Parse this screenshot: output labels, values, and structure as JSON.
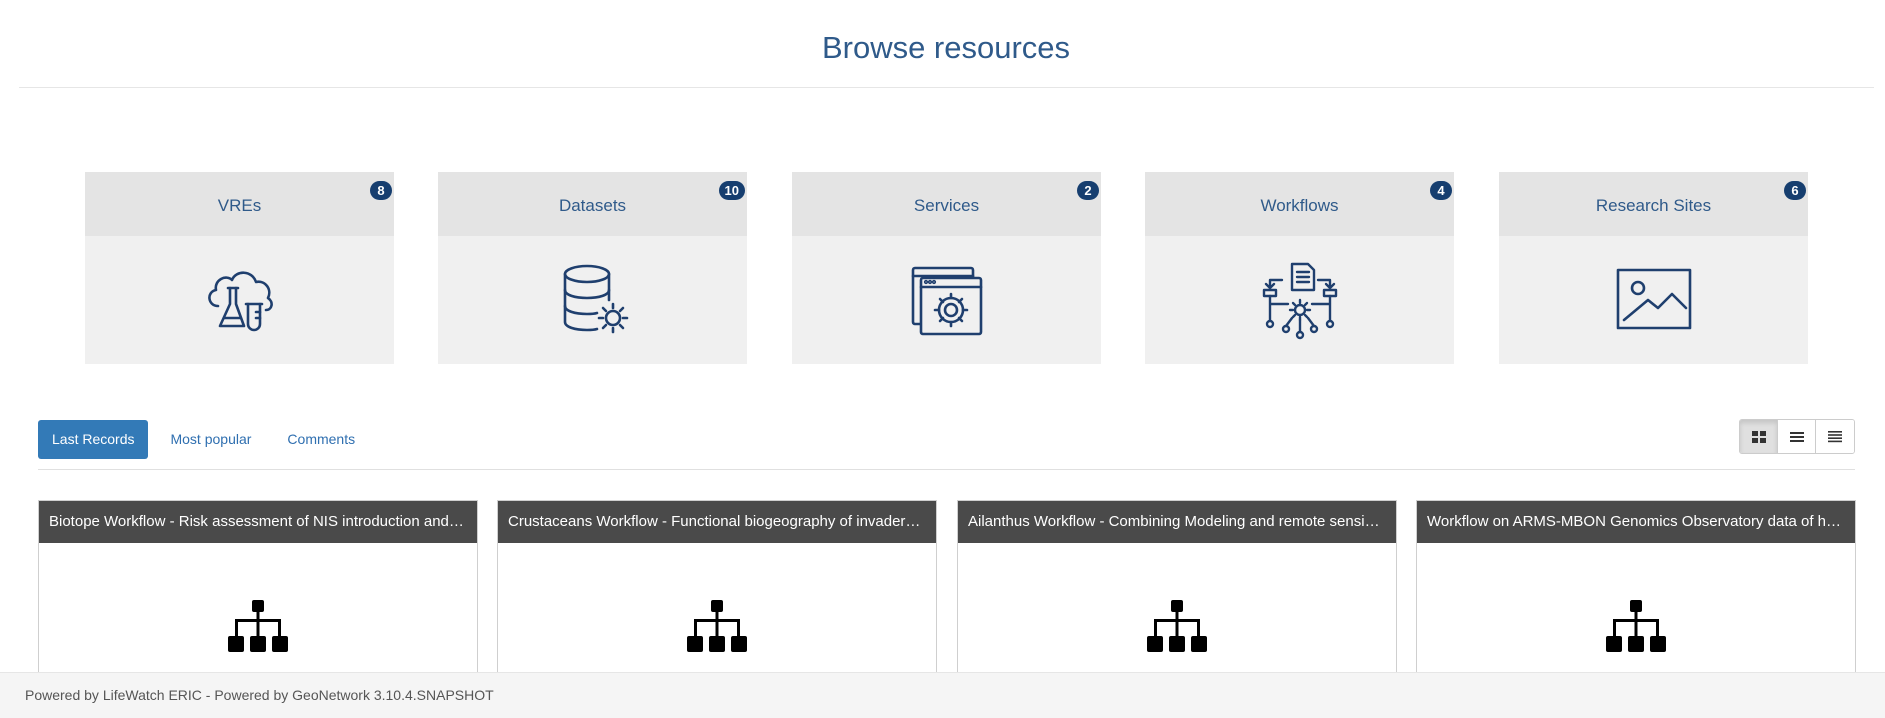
{
  "page": {
    "title": "Browse resources"
  },
  "categories": [
    {
      "label": "VREs",
      "count": "8",
      "icon": "cloud-lab-flask-icon"
    },
    {
      "label": "Datasets",
      "count": "10",
      "icon": "database-gear-icon"
    },
    {
      "label": "Services",
      "count": "2",
      "icon": "browser-gear-icon"
    },
    {
      "label": "Workflows",
      "count": "4",
      "icon": "workflow-network-icon"
    },
    {
      "label": "Research Sites",
      "count": "6",
      "icon": "image-landscape-icon"
    }
  ],
  "tabs": [
    {
      "label": "Last Records",
      "active": true
    },
    {
      "label": "Most popular",
      "active": false
    },
    {
      "label": "Comments",
      "active": false
    }
  ],
  "view_modes": [
    {
      "icon": "grid-view-icon",
      "active": true
    },
    {
      "icon": "list-view-icon",
      "active": false
    },
    {
      "icon": "compact-list-view-icon",
      "active": false
    }
  ],
  "records": [
    {
      "title": "Biotope Workflow - Risk assessment of NIS introduction and …",
      "icon": "sitemap-icon"
    },
    {
      "title": "Crustaceans Workflow - Functional biogeography of invader…",
      "icon": "sitemap-icon"
    },
    {
      "title": "Ailanthus Workflow - Combining Modeling and remote sensi…",
      "icon": "sitemap-icon"
    },
    {
      "title": "Workflow on ARMS-MBON Genomics Observatory data of h…",
      "icon": "sitemap-icon"
    }
  ],
  "footer": {
    "text": "Powered by LifeWatch ERIC - Powered by GeoNetwork 3.10.4.SNAPSHOT"
  },
  "colors": {
    "accent": "#337ab7",
    "title": "#2f5a8a",
    "badge": "#163e6f",
    "icon_stroke": "#1f3f6e",
    "card_header": "#4a4a4a"
  }
}
